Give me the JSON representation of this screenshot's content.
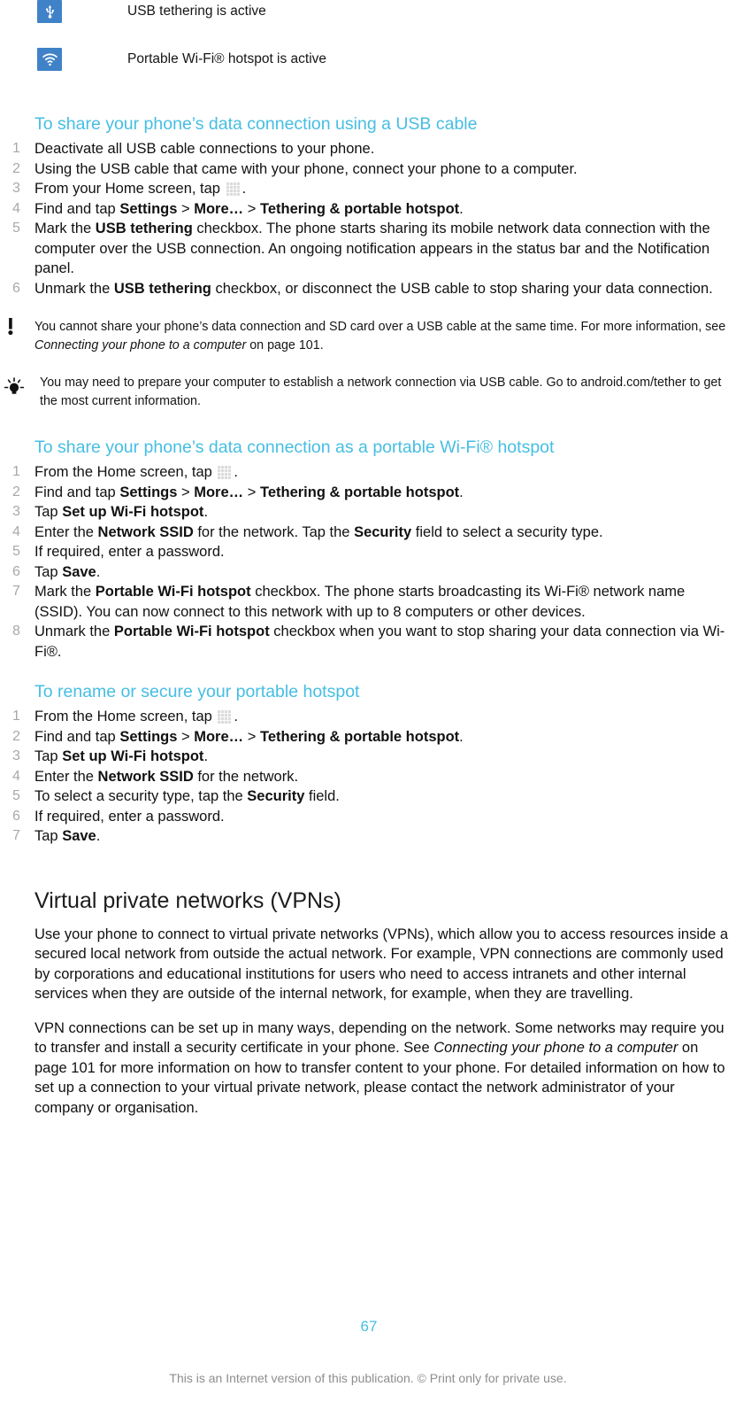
{
  "notifications": [
    {
      "icon": "usb-tethering-icon",
      "label": "USB tethering is active"
    },
    {
      "icon": "wifi-hotspot-icon",
      "label": "Portable Wi-Fi® hotspot is active"
    }
  ],
  "sections": [
    {
      "id": "usb-cable",
      "heading": "To share your phone’s data connection using a USB cable",
      "steps": [
        {
          "num": "1",
          "text": "Deactivate all USB cable connections to your phone."
        },
        {
          "num": "2",
          "text": "Using the USB cable that came with your phone, connect your phone to a computer."
        },
        {
          "num": "3",
          "text": "From your Home screen, tap  ."
        },
        {
          "num": "4",
          "text": "Find and tap Settings > More… > Tethering & portable hotspot."
        },
        {
          "num": "5",
          "text": "Mark the USB tethering checkbox. The phone starts sharing its mobile network data connection with the computer over the USB connection. An ongoing notification appears in the status bar and the Notification panel."
        },
        {
          "num": "6",
          "text": "Unmark the USB tethering checkbox, or disconnect the USB cable to stop sharing your data connection."
        }
      ]
    },
    {
      "id": "wifi-hotspot",
      "heading": "To share your phone’s data connection as a portable Wi-Fi® hotspot",
      "steps": [
        {
          "num": "1",
          "text": "From the Home screen, tap  ."
        },
        {
          "num": "2",
          "text": "Find and tap Settings > More… > Tethering & portable hotspot."
        },
        {
          "num": "3",
          "text": "Tap Set up Wi-Fi hotspot."
        },
        {
          "num": "4",
          "text": "Enter the Network SSID for the network. Tap the Security field to select a security type."
        },
        {
          "num": "5",
          "text": "If required, enter a password."
        },
        {
          "num": "6",
          "text": "Tap Save."
        },
        {
          "num": "7",
          "text": "Mark the Portable Wi-Fi hotspot checkbox. The phone starts broadcasting its Wi-Fi® network name (SSID). You can now connect to this network with up to 8 computers or other devices."
        },
        {
          "num": "8",
          "text": "Unmark the Portable Wi-Fi hotspot checkbox when you want to stop sharing your data connection via Wi-Fi®."
        }
      ]
    },
    {
      "id": "rename-hotspot",
      "heading": "To rename or secure your portable hotspot",
      "steps": [
        {
          "num": "1",
          "text": "From the Home screen, tap  ."
        },
        {
          "num": "2",
          "text": "Find and tap Settings > More… > Tethering & portable hotspot."
        },
        {
          "num": "3",
          "text": "Tap Set up Wi-Fi hotspot."
        },
        {
          "num": "4",
          "text": "Enter the Network SSID for the network."
        },
        {
          "num": "5",
          "text": "To select a security type, tap the Security field."
        },
        {
          "num": "6",
          "text": "If required, enter a password."
        },
        {
          "num": "7",
          "text": "Tap Save."
        }
      ]
    }
  ],
  "callouts": {
    "note": {
      "icon": "exclamation-icon",
      "text_part1": "You cannot share your phone’s data connection and SD card over a USB cable at the same time. For more information, see ",
      "text_italic": "Connecting your phone to a computer",
      "text_part2": " on page 101."
    },
    "tip": {
      "icon": "lightbulb-icon",
      "text": "You may need to prepare your computer to establish a network connection via USB cable. Go to android.com/tether to get the most current information."
    }
  },
  "vpn": {
    "heading": "Virtual private networks (VPNs)",
    "paragraph1": "Use your phone to connect to virtual private networks (VPNs), which allow you to access resources inside a secured local network from outside the actual network. For example, VPN connections are commonly used by corporations and educational institutions for users who need to access intranets and other internal services when they are outside of the internal network, for example, when they are travelling.",
    "paragraph2_part1": "VPN connections can be set up in many ways, depending on the network. Some networks may require you to transfer and install a security certificate in your phone. See ",
    "paragraph2_italic": "Connecting your phone to a computer",
    "paragraph2_part2": " on page 101 for more information on how to transfer content to your phone. For detailed information on how to set up a connection to your virtual private network, please contact the network administrator of your company or organisation."
  },
  "footer": {
    "page_number": "67",
    "legal": "This is an Internet version of this publication. © Print only for private use."
  },
  "colors": {
    "accent_cyan": "#46bee3",
    "icon_blue": "#3f82c8",
    "step_number_gray": "#a8a8a8",
    "legal_gray": "#8e8e8e"
  }
}
